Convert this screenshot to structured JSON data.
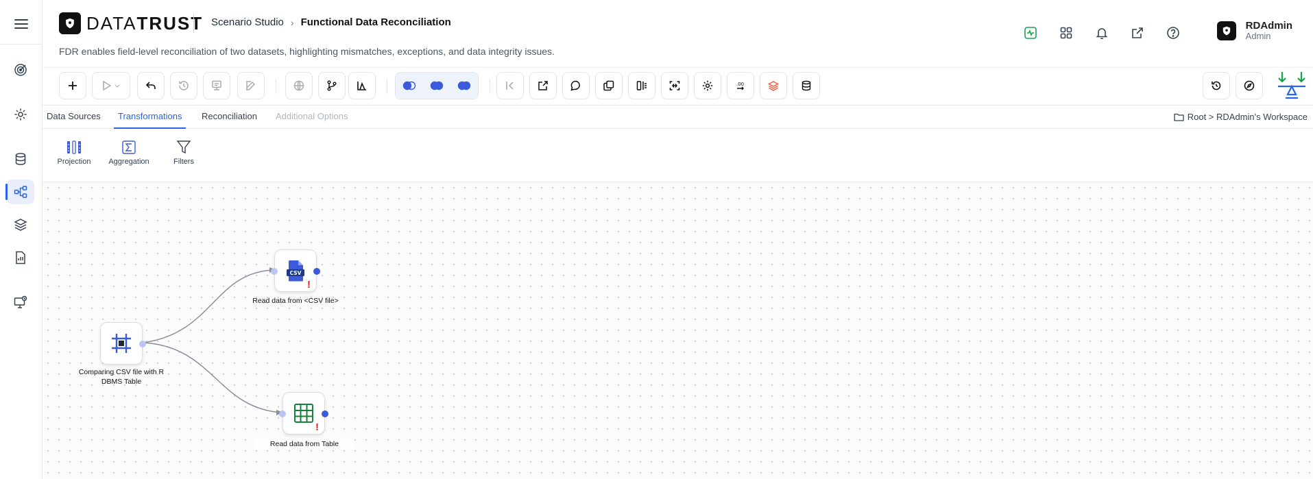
{
  "brand": {
    "name_light": "DATA",
    "name_bold": "TRUST"
  },
  "breadcrumb": {
    "section": "Scenario Studio",
    "page": "Functional Data Reconciliation"
  },
  "subtitle": "FDR enables field-level reconciliation of two datasets, highlighting mismatches, exceptions, and data integrity issues.",
  "user": {
    "name": "RDAdmin",
    "role": "Admin"
  },
  "header_icons": [
    "activity-icon",
    "apps-grid-icon",
    "bell-icon",
    "external-link-icon",
    "help-icon"
  ],
  "rail_items": [
    "target-icon",
    "gear-icon",
    "database-icon",
    "workflow-icon",
    "layers-icon",
    "report-icon",
    "monitor-icon"
  ],
  "tabs": {
    "data_sources": "Data Sources",
    "transformations": "Transformations",
    "reconciliation": "Reconciliation",
    "additional_options": "Additional Options"
  },
  "workspace_path": "Root > RDAdmin's Workspace",
  "palette": {
    "projection": "Projection",
    "aggregation": "Aggregation",
    "filters": "Filters"
  },
  "nodes": {
    "source": {
      "label_line1": "Comparing CSV file with R",
      "label_line2": "DBMS Table"
    },
    "csv": {
      "label": "Read data from <CSV file>",
      "badge": "CSV",
      "warning": "!"
    },
    "table": {
      "label": "Read data from Table",
      "warning": "!"
    }
  },
  "colors": {
    "accent": "#2563eb",
    "warning": "#dc2626",
    "balance_green": "#16a34a",
    "table_green": "#15803d"
  }
}
